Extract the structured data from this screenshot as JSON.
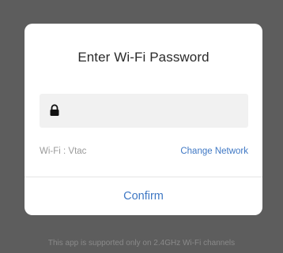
{
  "dialog": {
    "title": "Enter Wi-Fi Password",
    "password": {
      "value": "",
      "placeholder": ""
    },
    "wifi_label": "Wi-Fi : Vtac",
    "change_network_label": "Change Network",
    "confirm_label": "Confirm"
  },
  "footer": {
    "note": "This app is supported only on 2.4GHz Wi-Fi channels"
  },
  "icons": {
    "lock": "lock-icon"
  },
  "colors": {
    "accent": "#3f78c4",
    "backdrop": "#5d5d5d",
    "field_background": "#f1f1f1"
  }
}
